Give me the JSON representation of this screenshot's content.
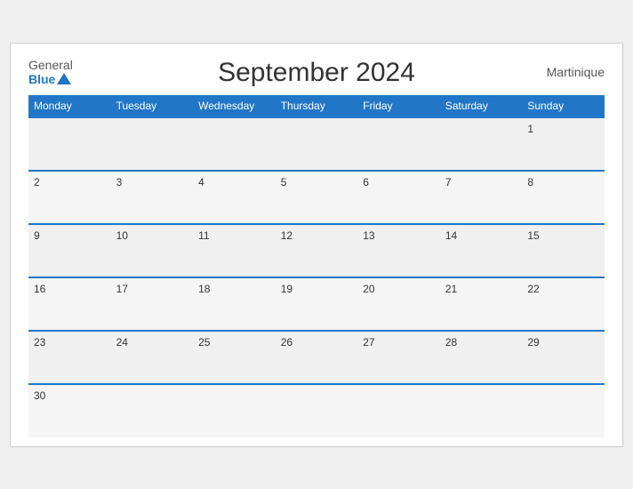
{
  "header": {
    "logo_general": "General",
    "logo_blue": "Blue",
    "title": "September 2024",
    "region": "Martinique"
  },
  "weekdays": [
    "Monday",
    "Tuesday",
    "Wednesday",
    "Thursday",
    "Friday",
    "Saturday",
    "Sunday"
  ],
  "weeks": [
    [
      null,
      null,
      null,
      null,
      null,
      null,
      1
    ],
    [
      2,
      3,
      4,
      5,
      6,
      7,
      8
    ],
    [
      9,
      10,
      11,
      12,
      13,
      14,
      15
    ],
    [
      16,
      17,
      18,
      19,
      20,
      21,
      22
    ],
    [
      23,
      24,
      25,
      26,
      27,
      28,
      29
    ],
    [
      30,
      null,
      null,
      null,
      null,
      null,
      null
    ]
  ]
}
